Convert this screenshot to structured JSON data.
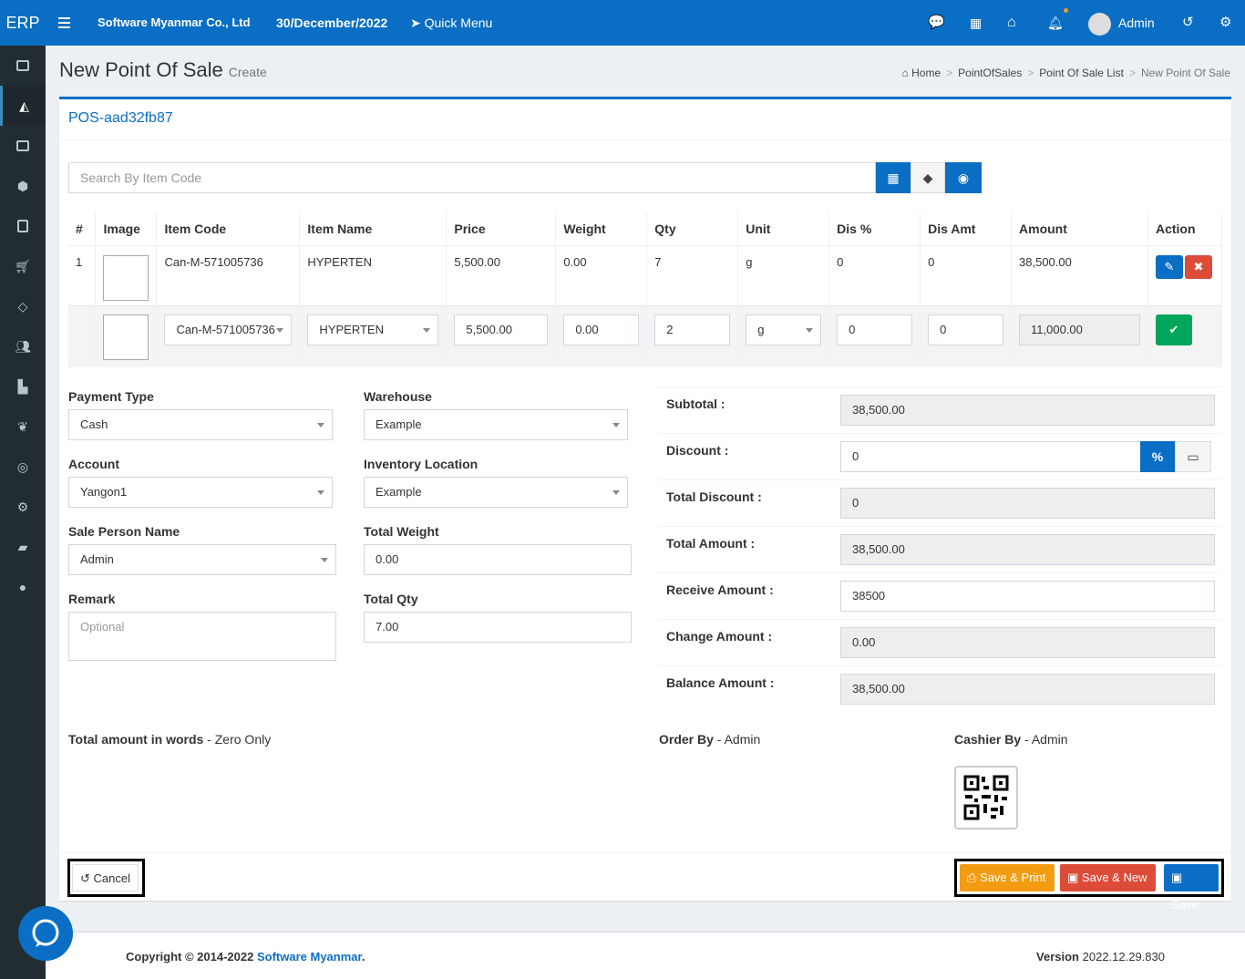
{
  "topbar": {
    "logo": "ERP",
    "company": "Software Myanmar Co., Ltd",
    "date": "30/December/2022",
    "quick_menu": "Quick Menu",
    "user": "Admin"
  },
  "page": {
    "title": "New Point Of Sale",
    "subtitle": "Create",
    "breadcrumb": [
      "Home",
      "PointOfSales",
      "Point Of Sale List",
      "New Point Of Sale"
    ]
  },
  "form": {
    "doc_no": "POS-aad32fb87",
    "search_placeholder": "Search By Item Code"
  },
  "table": {
    "headers": [
      "#",
      "Image",
      "Item Code",
      "Item Name",
      "Price",
      "Weight",
      "Qty",
      "Unit",
      "Dis %",
      "Dis Amt",
      "Amount",
      "Action"
    ],
    "rows": [
      {
        "no": "1",
        "item_code": "Can-M-571005736",
        "item_name": "HYPERTEN",
        "price": "5,500.00",
        "weight": "0.00",
        "qty": "7",
        "unit": "g",
        "dis_pct": "0",
        "dis_amt": "0",
        "amount": "38,500.00"
      }
    ],
    "entry": {
      "item_code": "Can-M-571005736",
      "item_name": "HYPERTEN",
      "price": "5,500.00",
      "weight": "0.00",
      "qty": "2",
      "unit": "g",
      "dis_pct": "0",
      "dis_amt": "0",
      "amount": "11,000.00"
    }
  },
  "details": {
    "payment_type_label": "Payment Type",
    "payment_type": "Cash",
    "warehouse_label": "Warehouse",
    "warehouse": "Example",
    "account_label": "Account",
    "account": "Yangon1",
    "inventory_label": "Inventory Location",
    "inventory": "Example",
    "sale_person_label": "Sale Person Name",
    "sale_person": "Admin",
    "total_weight_label": "Total Weight",
    "total_weight": "0.00",
    "remark_label": "Remark",
    "remark_placeholder": "Optional",
    "total_qty_label": "Total Qty",
    "total_qty": "7.00"
  },
  "summary": {
    "subtotal_label": "Subtotal :",
    "subtotal": "38,500.00",
    "discount_label": "Discount :",
    "discount": "0",
    "discount_pct_btn": "%",
    "total_discount_label": "Total Discount :",
    "total_discount": "0",
    "total_amount_label": "Total Amount :",
    "total_amount": "38,500.00",
    "receive_label": "Receive Amount :",
    "receive": "38500",
    "change_label": "Change Amount :",
    "change": "0.00",
    "balance_label": "Balance Amount :",
    "balance": "38,500.00"
  },
  "bottom": {
    "words_label": "Total amount in words",
    "words": "Zero Only",
    "order_label": "Order By",
    "order_by": "Admin",
    "cashier_label": "Cashier By",
    "cashier_by": "Admin"
  },
  "buttons": {
    "cancel": "Cancel",
    "save_print": "Save & Print",
    "save_new": "Save & New",
    "save": "Save"
  },
  "footer": {
    "copyright": "Copyright © 2014-2022",
    "company_link": "Software Myanmar",
    "version_label": "Version",
    "version": "2022.12.29.830"
  },
  "colors": {
    "primary": "#0a6ec4",
    "sidebar": "#222d32",
    "success": "#00a65a",
    "danger": "#dd4b39",
    "warning": "#f39c12"
  }
}
